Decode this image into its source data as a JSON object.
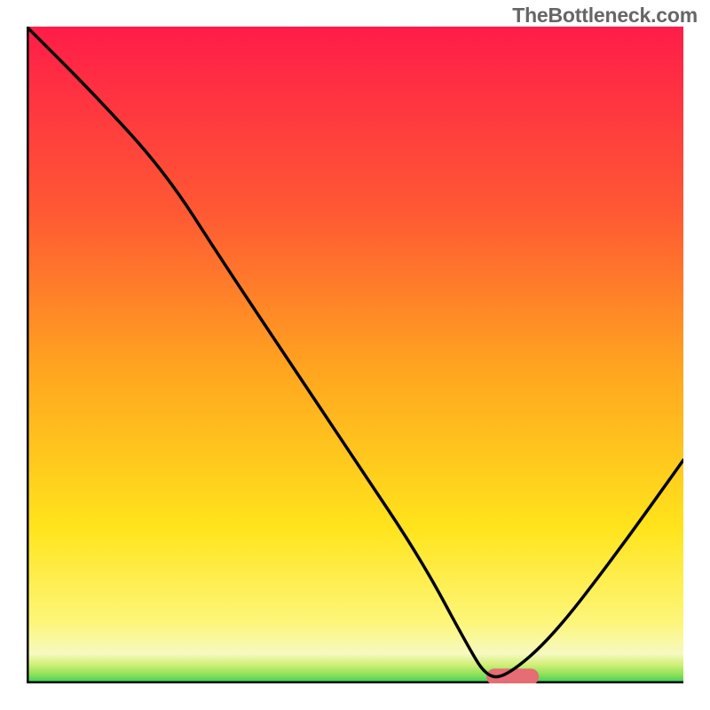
{
  "watermark": "TheBottleneck.com",
  "colors": {
    "axis": "#000000",
    "curve": "#000000",
    "optimal_bar": "#e56d73"
  },
  "chart_data": {
    "type": "line",
    "title": "",
    "xlabel": "",
    "ylabel": "",
    "xlim": [
      0,
      100
    ],
    "ylim": [
      0,
      100
    ],
    "background": {
      "kind": "vertical-gradient",
      "top_to_bottom": [
        "#ff1c49",
        "#ff5a33",
        "#ffa61f",
        "#ffe41c",
        "#fdf67a",
        "#2ecf60"
      ],
      "green_band_fraction": 0.045
    },
    "series": [
      {
        "name": "bottleneck-curve",
        "x": [
          0,
          10,
          21,
          30,
          40,
          50,
          60,
          67,
          70,
          73,
          80,
          90,
          100
        ],
        "y": [
          100,
          90,
          78,
          64,
          49,
          34,
          19,
          6,
          1,
          1,
          7,
          20,
          34
        ]
      }
    ],
    "optimal_region": {
      "x_start": 70,
      "x_end": 78,
      "y": 1,
      "height": 2.5
    },
    "axes": {
      "show_ticks": false,
      "show_gridlines": false
    }
  }
}
